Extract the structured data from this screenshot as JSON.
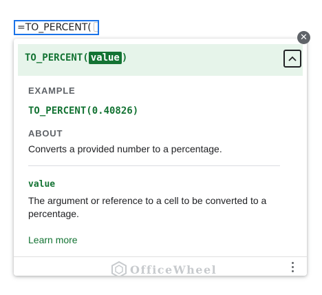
{
  "formula_bar": {
    "value": "=TO_PERCENT("
  },
  "popup": {
    "close_icon": "close-icon",
    "signature": {
      "function_name": "TO_PERCENT(",
      "param": "value",
      "close_paren": ")"
    },
    "collapse_icon": "chevron-up-icon",
    "example": {
      "title": "EXAMPLE",
      "code": "TO_PERCENT(0.40826)"
    },
    "about": {
      "title": "ABOUT",
      "text": "Converts a provided number to a percentage."
    },
    "parameter": {
      "name": "value",
      "description": "The argument or reference to a cell to be converted to a percentage."
    },
    "learn_more": "Learn more",
    "footer": {
      "watermark": "OfficeWheel",
      "more_icon": "more-vert-icon"
    }
  },
  "colors": {
    "accent_green": "#137333",
    "header_bg": "#e6f4ea",
    "focus_blue": "#1a73e8"
  }
}
